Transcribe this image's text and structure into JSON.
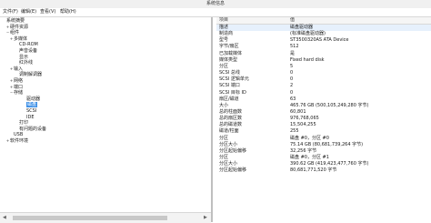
{
  "window": {
    "title": "系统信息"
  },
  "menu": {
    "items": [
      "文件(F)",
      "编辑(E)",
      "查看(V)",
      "帮助(H)"
    ]
  },
  "tree": {
    "items": [
      {
        "label": "系统摘要",
        "level": 0,
        "toggle": ""
      },
      {
        "label": "硬件资源",
        "level": 1,
        "toggle": "+"
      },
      {
        "label": "组件",
        "level": 1,
        "toggle": "−"
      },
      {
        "label": "多媒体",
        "level": 2,
        "toggle": "+"
      },
      {
        "label": "CD-ROM",
        "level": 3,
        "toggle": ""
      },
      {
        "label": "声音设备",
        "level": 3,
        "toggle": ""
      },
      {
        "label": "显示",
        "level": 3,
        "toggle": ""
      },
      {
        "label": "红外线",
        "level": 3,
        "toggle": ""
      },
      {
        "label": "输入",
        "level": 2,
        "toggle": "+"
      },
      {
        "label": "调制解调器",
        "level": 3,
        "toggle": ""
      },
      {
        "label": "网络",
        "level": 2,
        "toggle": "+"
      },
      {
        "label": "端口",
        "level": 2,
        "toggle": "+"
      },
      {
        "label": "存储",
        "level": 2,
        "toggle": "−"
      },
      {
        "label": "驱动器",
        "level": 4,
        "toggle": ""
      },
      {
        "label": "磁盘",
        "level": 4,
        "toggle": "",
        "selected": true
      },
      {
        "label": "SCSI",
        "level": 4,
        "toggle": ""
      },
      {
        "label": "IDE",
        "level": 4,
        "toggle": ""
      },
      {
        "label": "打印",
        "level": 3,
        "toggle": ""
      },
      {
        "label": "有问题的设备",
        "level": 3,
        "toggle": ""
      },
      {
        "label": "USB",
        "level": 2,
        "toggle": ""
      },
      {
        "label": "软件环境",
        "level": 1,
        "toggle": "+"
      }
    ]
  },
  "details": {
    "col_item": "项目",
    "col_value": "值",
    "rows": [
      {
        "k": "描述",
        "v": "磁盘驱动器",
        "selected": true
      },
      {
        "k": "制造商",
        "v": "(标准磁盘驱动器)"
      },
      {
        "k": "型号",
        "v": "ST3500320AS ATA Device"
      },
      {
        "k": "字节/扇区",
        "v": "512"
      },
      {
        "k": "已加载媒体",
        "v": "是"
      },
      {
        "k": "媒体类型",
        "v": "Fixed hard disk"
      },
      {
        "k": "分区",
        "v": "5"
      },
      {
        "k": "SCSI 总线",
        "v": "0"
      },
      {
        "k": "SCSI 逻辑单元",
        "v": "0"
      },
      {
        "k": "SCSI 端口",
        "v": "2"
      },
      {
        "k": "SCSI 目标 ID",
        "v": "0"
      },
      {
        "k": "扇区/磁道",
        "v": "63"
      },
      {
        "k": "大小",
        "v": "465.76 GB (500,105,249,280 字节)"
      },
      {
        "k": "总的柱面数",
        "v": "60,801"
      },
      {
        "k": "总的扇区数",
        "v": "976,768,065"
      },
      {
        "k": "总的磁道数",
        "v": "15,504,255"
      },
      {
        "k": "磁道/柱面",
        "v": "255"
      },
      {
        "k": "分区",
        "v": "磁盘 #0，分区 #0"
      },
      {
        "k": "分区大小",
        "v": "75.14 GB (80,681,739,264 字节)"
      },
      {
        "k": "分区起始偏移",
        "v": "32,256 字节"
      },
      {
        "k": "分区",
        "v": "磁盘 #0，分区 #1"
      },
      {
        "k": "分区大小",
        "v": "390.62 GB (419,423,477,760 字节)"
      },
      {
        "k": "分区起始偏移",
        "v": "80,681,771,520 字节"
      }
    ]
  }
}
